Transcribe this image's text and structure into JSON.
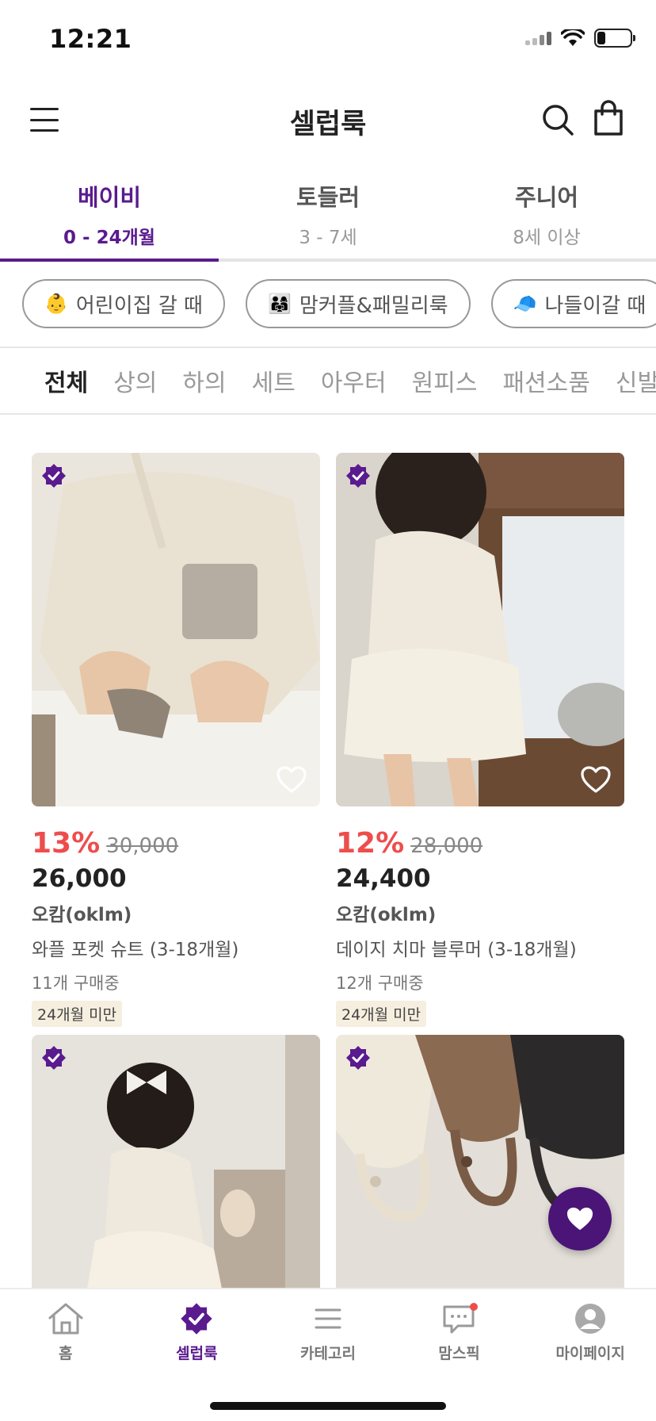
{
  "status": {
    "time": "12:21"
  },
  "header": {
    "title": "셀럽룩"
  },
  "age_tabs": [
    {
      "label": "베이비",
      "range": "0 - 24개월",
      "active": true
    },
    {
      "label": "토들러",
      "range": "3 - 7세",
      "active": false
    },
    {
      "label": "주니어",
      "range": "8세 이상",
      "active": false
    }
  ],
  "chips": [
    {
      "emoji": "👶",
      "label": "어린이집 갈 때"
    },
    {
      "emoji": "👨‍👩‍👧",
      "label": "맘커플&패밀리룩"
    },
    {
      "emoji": "🧢",
      "label": "나들이갈 때"
    }
  ],
  "categories": [
    "전체",
    "상의",
    "하의",
    "세트",
    "아우터",
    "원피스",
    "패션소품",
    "신발"
  ],
  "products": [
    {
      "discount": "13%",
      "original_price": "30,000",
      "price": "26,000",
      "brand": "오캄(oklm)",
      "name": "와플 포켓 슈트 (3-18개월)",
      "buying": "11개 구매중",
      "tag": "24개월 미만"
    },
    {
      "discount": "12%",
      "original_price": "28,000",
      "price": "24,400",
      "brand": "오캄(oklm)",
      "name": "데이지 치마 블루머 (3-18개월)",
      "buying": "12개 구매중",
      "tag": "24개월 미만"
    },
    {},
    {}
  ],
  "bottom_nav": [
    {
      "label": "홈",
      "icon": "home-icon"
    },
    {
      "label": "셀럽룩",
      "icon": "verified-badge-icon",
      "active": true
    },
    {
      "label": "카테고리",
      "icon": "list-icon"
    },
    {
      "label": "맘스픽",
      "icon": "chat-icon"
    },
    {
      "label": "마이페이지",
      "icon": "profile-icon"
    }
  ],
  "colors": {
    "accent": "#5a1b8e",
    "discount": "#ee4d4d",
    "tag_bg": "#f6eedf"
  }
}
